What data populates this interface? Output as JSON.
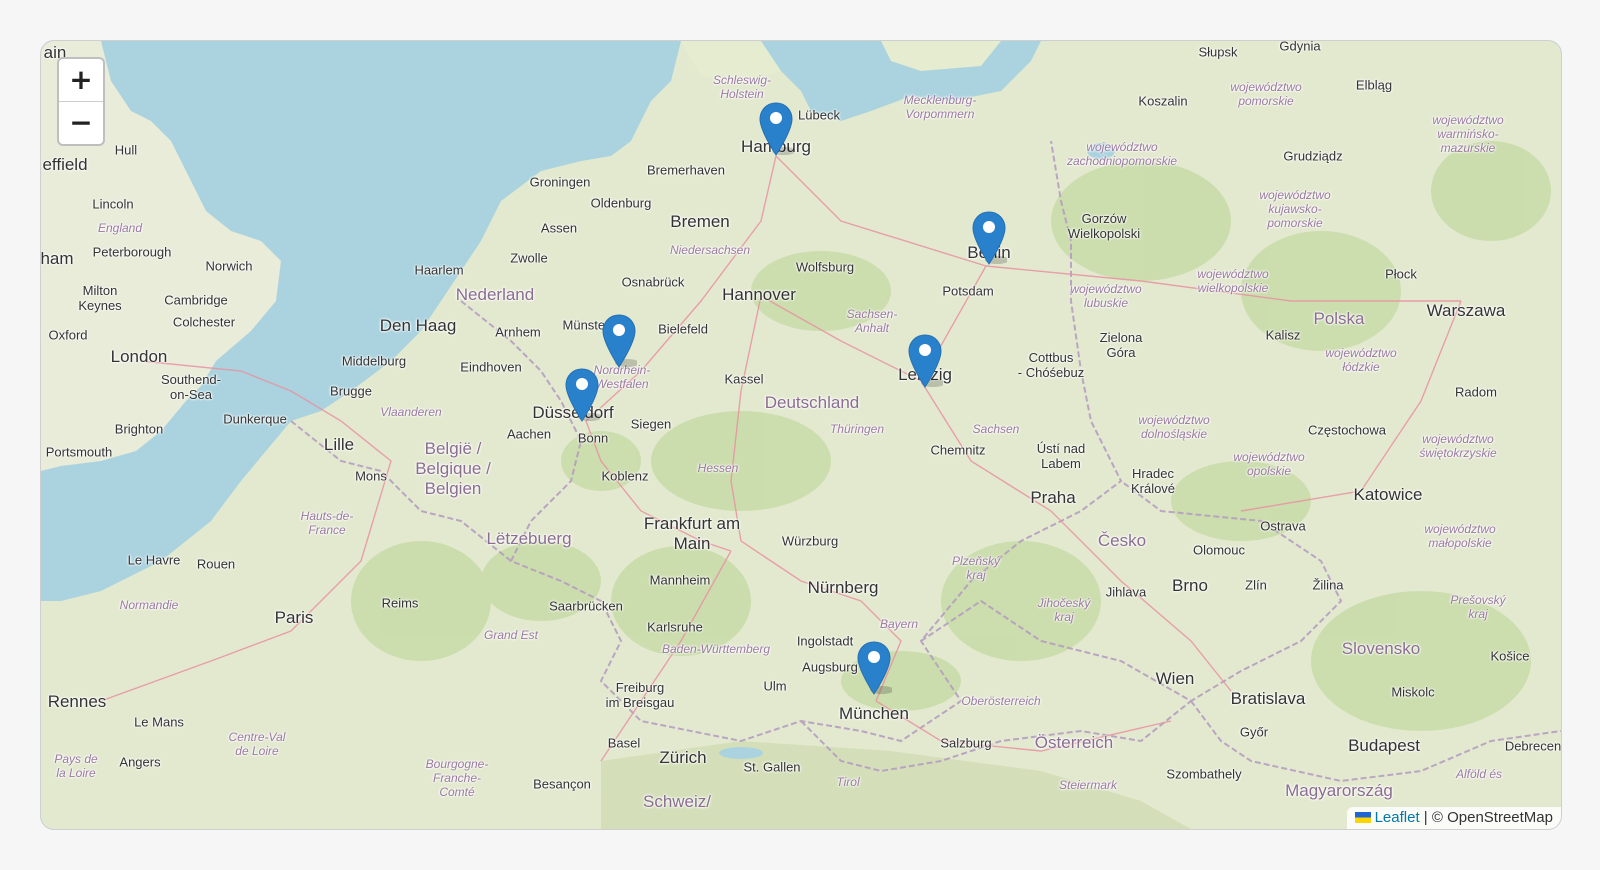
{
  "map": {
    "zoom_in_label": "+",
    "zoom_out_label": "−",
    "attribution": {
      "leaflet_link": "Leaflet",
      "separator": " | © ",
      "osm": "OpenStreetMap"
    },
    "markers": [
      {
        "name": "Hamburg"
      },
      {
        "name": "Berlin"
      },
      {
        "name": "Münster"
      },
      {
        "name": "Düsseldorf"
      },
      {
        "name": "Leipzig"
      },
      {
        "name": "München"
      }
    ],
    "marker_color": "#2a81cb",
    "labels": {
      "groningen": "Groningen",
      "bremerhaven": "Bremerhaven",
      "oldenburg": "Oldenburg",
      "bremen": "Bremen",
      "assen": "Assen",
      "zwolle": "Zwolle",
      "haarlem": "Haarlem",
      "nederland": "Nederland",
      "den_haag": "Den Haag",
      "arnhem": "Arnhem",
      "muenster": "Münster",
      "bielefeld": "Bielefeld",
      "osnabrueck": "Osnabrück",
      "niedersachsen": "Niedersachsen",
      "wolfsburg": "Wolfsburg",
      "hannover": "Hannover",
      "hamburg": "Hamburg",
      "luebeck": "Lübeck",
      "schleswig_holstein": "Schleswig-\nHolstein",
      "mecklenburg": "Mecklenburg-\nVorpommern",
      "berlin": "Berlin",
      "potsdam": "Potsdam",
      "sachsen_anhalt": "Sachsen-\nAnhalt",
      "leipzig": "Leipzig",
      "cottbus": "Cottbus\n- Chóśebuz",
      "deutschland": "Deutschland",
      "thueringen": "Thüringen",
      "sachsen": "Sachsen",
      "chemnitz": "Chemnitz",
      "kassel": "Kassel",
      "nrw": "Nordrhein-\nWestfalen",
      "duesseldorf": "Düsseldorf",
      "aachen": "Aachen",
      "bonn": "Bonn",
      "siegen": "Siegen",
      "koblenz": "Koblenz",
      "hessen": "Hessen",
      "frankfurt": "Frankfurt am\nMain",
      "wuerzburg": "Würzburg",
      "mannheim": "Mannheim",
      "nuernberg": "Nürnberg",
      "saarbruecken": "Saarbrücken",
      "karlsruhe": "Karlsruhe",
      "bw": "Baden-Württemberg",
      "ingolstadt": "Ingolstadt",
      "bayern": "Bayern",
      "augsburg": "Augsburg",
      "ulm": "Ulm",
      "muenchen": "München",
      "freiburg": "Freiburg\nim Breisgau",
      "basel": "Basel",
      "zuerich": "Zürich",
      "st_gallen": "St. Gallen",
      "schweiz": "Schweiz/",
      "tirol": "Tirol",
      "salzburg": "Salzburg",
      "oesterreich": "Österreich",
      "oberoesterreich": "Oberösterreich",
      "steiermark": "Steiermark",
      "wien": "Wien",
      "bratislava": "Bratislava",
      "gyor": "Győr",
      "szombathely": "Szombathely",
      "budapest": "Budapest",
      "magyarorszag": "Magyarország",
      "alfold": "Alföld és",
      "debrecen": "Debrecen",
      "slovensko": "Slovensko",
      "kosice": "Košice",
      "miskolc": "Miskolc",
      "presovsky": "Prešovský\nkraj",
      "zilina": "Žilina",
      "zlin": "Zlín",
      "brno": "Brno",
      "olomouc": "Olomouc",
      "ostrava": "Ostrava",
      "jihlava": "Jihlava",
      "jihocesky": "Jihočeský\nkraj",
      "plzensky": "Plzeňský\nkraj",
      "cesko": "Česko",
      "praha": "Praha",
      "usti": "Ústí nad\nLabem",
      "hradec": "Hradec\nKrálové",
      "dolnoslaskie": "województwo\ndolnośląskie",
      "opolskie": "województwo\nopolskie",
      "katowice": "Katowice",
      "malopolskie": "województwo\nmałopolskie",
      "czestochowa": "Częstochowa",
      "swietokrzyskie": "województwo\nświętokrzyskie",
      "radom": "Radom",
      "lodzkie": "województwo\nłódzkie",
      "polska": "Polska",
      "warszawa": "Warszawa",
      "plock": "Płock",
      "kalisz": "Kalisz",
      "zielona_gora": "Zielona\nGóra",
      "lubuskie": "województwo\nlubuskie",
      "wielkopolskie": "województwo\nwielkopolskie",
      "gorzow": "Gorzów\nWielkopolski",
      "kujawsko": "województwo\nkujawsko-\npomorskie",
      "grudziadz": "Grudziądz",
      "zachodniopomorskie": "województwo\nzachodniopomorskie",
      "koszalin": "Koszalin",
      "pomorskie": "województwo\npomorskie",
      "slupsk": "Słupsk",
      "gdynia": "Gdynia",
      "elblag": "Elbląg",
      "warminsko": "województwo\nwarmińsko-\nmazurskie",
      "hull": "Hull",
      "sheffield": "effield",
      "lincoln": "Lincoln",
      "england": "England",
      "peterborough": "Peterborough",
      "norwich": "Norwich",
      "nham": "ham",
      "milton_keynes": "Milton\nKeynes",
      "cambridge": "Cambridge",
      "colchester": "Colchester",
      "oxford": "Oxford",
      "london": "London",
      "southend": "Southend-\non-Sea",
      "brighton": "Brighton",
      "portsmouth": "Portsmouth",
      "middelburg": "Middelburg",
      "eindhoven": "Eindhoven",
      "brugge": "Brugge",
      "vlaanderen": "Vlaanderen",
      "dunkerque": "Dunkerque",
      "lille": "Lille",
      "belgie": "België /\nBelgique /\nBelgien",
      "mons": "Mons",
      "letzebuerg": "Lëtzebuerg",
      "hauts_de_france": "Hauts-de-\nFrance",
      "le_havre": "Le Havre",
      "rouen": "Rouen",
      "normandie": "Normandie",
      "reims": "Reims",
      "paris": "Paris",
      "grand_est": "Grand Est",
      "rennes": "Rennes",
      "le_mans": "Le Mans",
      "centre": "Centre-Val\nde Loire",
      "pays_de_loire": "Pays de\nla Loire",
      "angers": "Angers",
      "bourgogne": "Bourgogne-\nFranche-\nComté",
      "besancon": "Besançon",
      "ham": "ham",
      "lbt": "ain"
    }
  }
}
